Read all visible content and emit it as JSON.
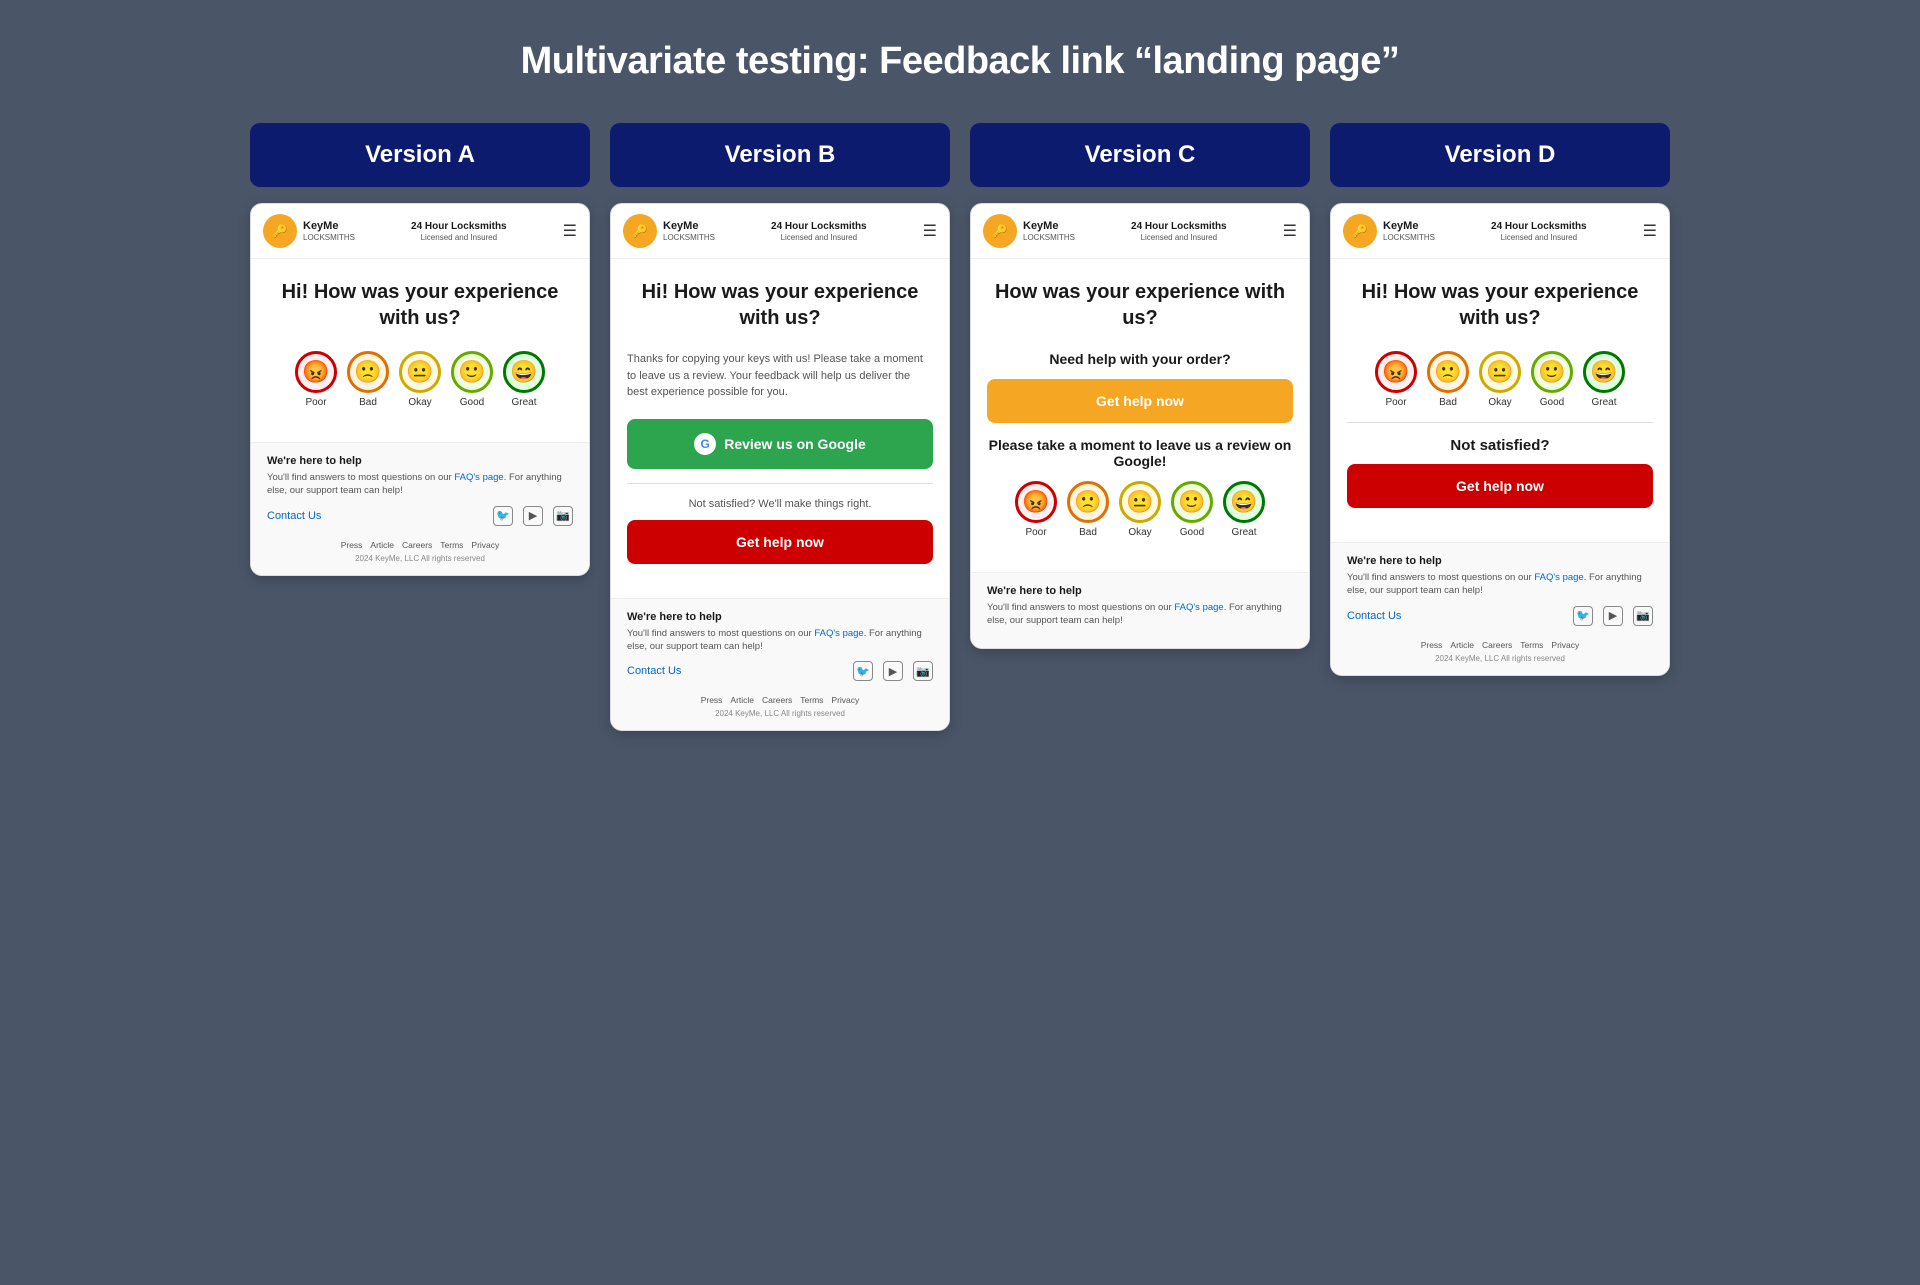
{
  "page": {
    "title": "Multivariate testing: Feedback link “landing page”"
  },
  "brand": {
    "name": "KeyMe",
    "subtitle": "LOCKSMITHS",
    "nav_title": "24 Hour Locksmiths",
    "nav_sub": "Licensed and Insured"
  },
  "versions": [
    {
      "id": "A",
      "header": "Version A",
      "main_question": "Hi! How was your experience with us?",
      "emojis": [
        {
          "type": "poor",
          "face": "😡",
          "label": "Poor"
        },
        {
          "type": "bad",
          "face": "🙁",
          "label": "Bad"
        },
        {
          "type": "okay",
          "face": "😐",
          "label": "Okay"
        },
        {
          "type": "good",
          "face": "🙂",
          "label": "Good"
        },
        {
          "type": "great",
          "face": "😄",
          "label": "Great"
        }
      ],
      "footer": {
        "help_title": "We're here to help",
        "help_text": "You'll find answers to most questions on our ",
        "faq_link": "FAQ's page",
        "help_text2": ". For anything else, our support team can help!",
        "contact": "Contact Us",
        "links": [
          "Press",
          "Article",
          "Careers",
          "Terms",
          "Privacy"
        ],
        "copyright": "2024 KeyMe, LLC All rights reserved"
      }
    },
    {
      "id": "B",
      "header": "Version B",
      "main_question": "Hi! How was your experience with us?",
      "description": "Thanks for copying your keys with us! Please take a moment to leave us a review. Your feedback will help us deliver the best experience possible for you.",
      "google_btn": "Review us on Google",
      "not_satisfied": "Not satisfied? We'll make things right.",
      "help_btn": "Get help now",
      "footer": {
        "help_title": "We're here to help",
        "help_text": "You'll find answers to most questions on our ",
        "faq_link": "FAQ's page",
        "help_text2": ". For anything else, our support team can help!",
        "contact": "Contact Us",
        "links": [
          "Press",
          "Article",
          "Careers",
          "Terms",
          "Privacy"
        ],
        "copyright": "2024 KeyMe, LLC All rights reserved"
      }
    },
    {
      "id": "C",
      "header": "Version C",
      "main_question": "How was your experience with us?",
      "need_help": "Need help with your order?",
      "help_btn_yellow": "Get help now",
      "google_review_invite": "Please take a moment to leave us a review on Google!",
      "emojis": [
        {
          "type": "poor",
          "face": "😡",
          "label": "Poor"
        },
        {
          "type": "bad",
          "face": "🙁",
          "label": "Bad"
        },
        {
          "type": "okay",
          "face": "😐",
          "label": "Okay"
        },
        {
          "type": "good",
          "face": "🙂",
          "label": "Good"
        },
        {
          "type": "great",
          "face": "😄",
          "label": "Great"
        }
      ],
      "footer": {
        "help_title": "We're here to help",
        "help_text": "You'll find answers to most questions on our ",
        "faq_link": "FAQ's page",
        "help_text2": ". For anything else, our support team can help!"
      }
    },
    {
      "id": "D",
      "header": "Version D",
      "main_question": "Hi! How was your experience with us?",
      "emojis": [
        {
          "type": "poor",
          "face": "😡",
          "label": "Poor"
        },
        {
          "type": "bad",
          "face": "🙁",
          "label": "Bad"
        },
        {
          "type": "okay",
          "face": "😐",
          "label": "Okay"
        },
        {
          "type": "good",
          "face": "🙂",
          "label": "Good"
        },
        {
          "type": "great",
          "face": "😄",
          "label": "Great"
        }
      ],
      "not_satisfied": "Not satisfied?",
      "help_btn": "Get help now",
      "footer": {
        "help_title": "We're here to help",
        "help_text": "You'll find answers to most questions on our ",
        "faq_link": "FAQ's page",
        "help_text2": ". For anything else, our support team can help!",
        "contact": "Contact Us",
        "links": [
          "Press",
          "Article",
          "Careers",
          "Terms",
          "Privacy"
        ],
        "copyright": "2024 KeyMe, LLC All rights reserved"
      }
    }
  ]
}
